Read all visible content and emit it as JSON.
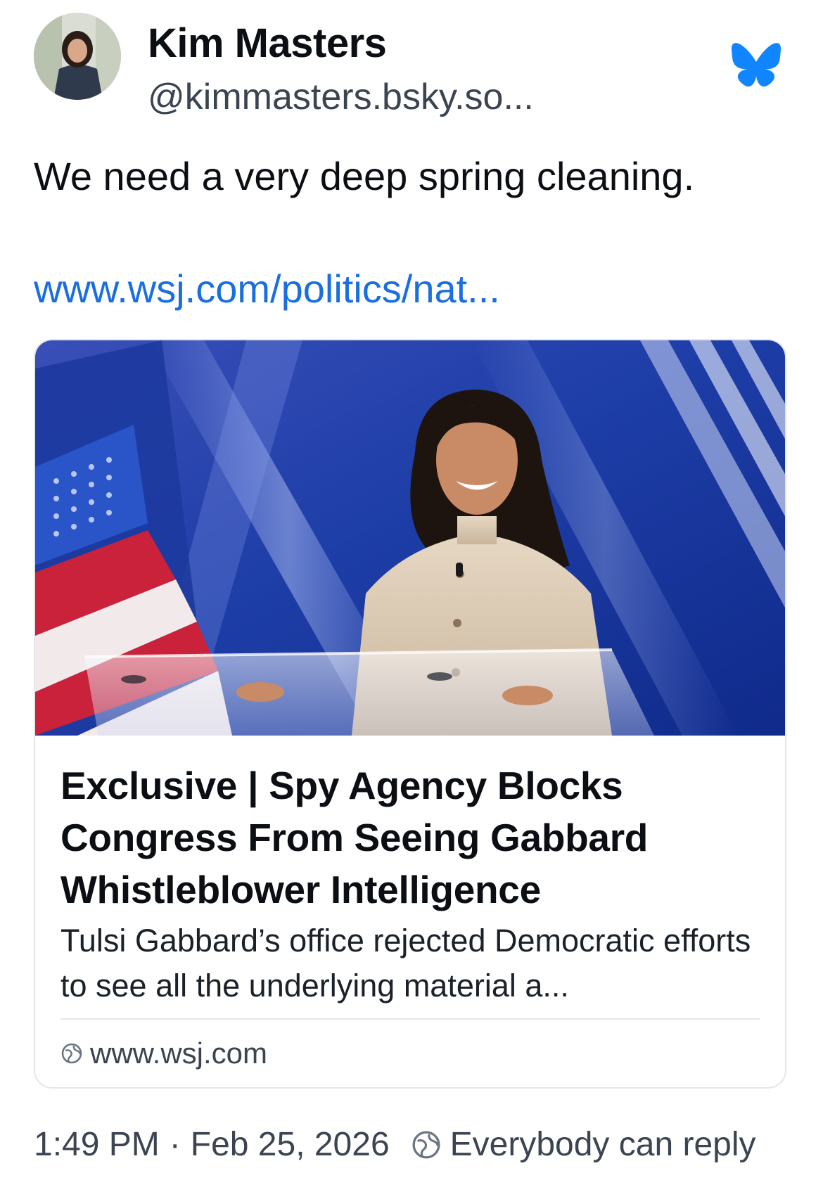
{
  "author": {
    "display_name": "Kim Masters",
    "handle": "@kimmasters.bsky.so...",
    "avatar_icon": "avatar-photo"
  },
  "brand": {
    "logo_icon": "bluesky-butterfly-icon",
    "color": "#1185fe"
  },
  "post": {
    "text": "We need a very deep spring cleaning.",
    "link_text": "www.wsj.com/politics/nat...",
    "link_color": "#1a6fe0"
  },
  "card": {
    "image_alt": "Woman smiling at a podium in front of a blue stage backdrop and an American flag",
    "title": "Exclusive | Spy Agency Blocks Congress From Seeing Gabbard Whistleblower Intelligence",
    "description": "Tulsi Gabbard’s office rejected Democratic efforts to see all the underlying material a...",
    "domain": "www.wsj.com",
    "domain_icon": "globe-icon"
  },
  "footer": {
    "time": "1:49 PM",
    "separator": "·",
    "date": "Feb 25, 2026",
    "reply_icon": "globe-icon",
    "reply_setting": "Everybody can reply"
  }
}
